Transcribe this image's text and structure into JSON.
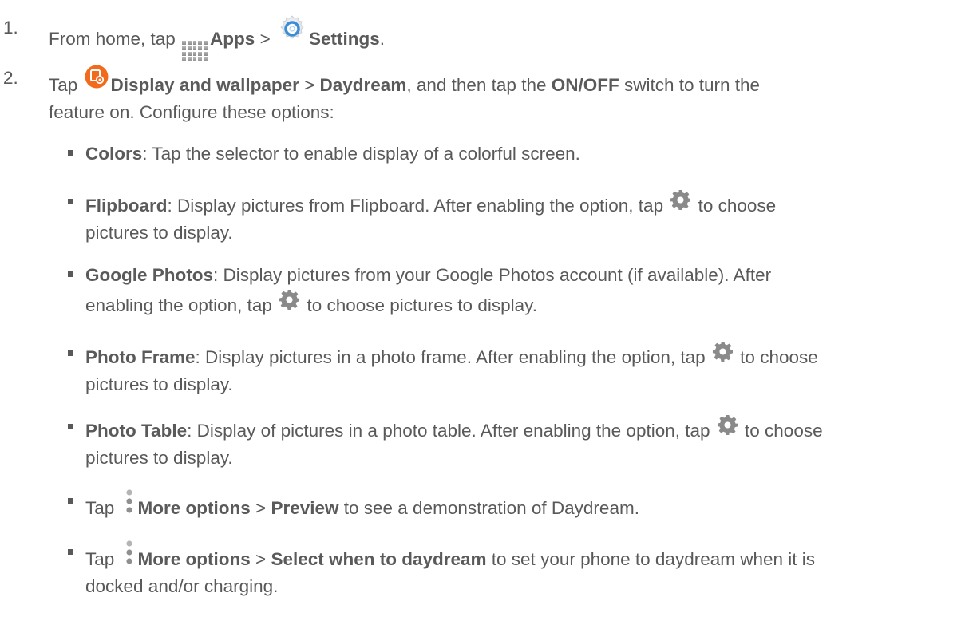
{
  "step1": {
    "number": "1.",
    "text_a": "From home, tap ",
    "apps_label": "Apps",
    "text_b": " > ",
    "settings_label": "Settings",
    "text_c": "."
  },
  "step2": {
    "number": "2.",
    "text_a": "Tap ",
    "display_label": "Display and wallpaper",
    "text_b": " > ",
    "daydream_label": "Daydream",
    "text_c": ", and then tap the ",
    "onoff_label": "ON/OFF",
    "text_d": " switch to turn the",
    "line2": "feature on. Configure these options:"
  },
  "options": [
    {
      "term": "Colors",
      "text": ": Tap the selector to enable display of a colorful screen."
    },
    {
      "term": "Flipboard",
      "text_a": ": Display pictures from Flipboard. After enabling the option, tap ",
      "text_b": " to choose",
      "line2": "pictures to display."
    },
    {
      "term": "Google Photos",
      "text_a": ": Display pictures from your Google Photos account (if available). After",
      "line2_a": "enabling the option, tap ",
      "line2_b": " to choose pictures to display."
    },
    {
      "term": "Photo Frame",
      "text_a": ": Display pictures in a photo frame. After enabling the option, tap ",
      "text_b": " to choose",
      "line2": "pictures to display."
    },
    {
      "term": "Photo Table",
      "text_a": ": Display of pictures in a photo table. After enabling the option, tap ",
      "text_b": " to choose",
      "line2": "pictures to display."
    },
    {
      "text_a": "Tap ",
      "more_label": "More options",
      "text_b": " > ",
      "preview_label": "Preview",
      "text_c": " to see a demonstration of Daydream."
    },
    {
      "text_a": "Tap ",
      "more_label": "More options",
      "text_b": " > ",
      "select_label": "Select when to daydream",
      "text_c": " to set your phone to daydream when it is",
      "line2": "docked and/or charging."
    }
  ],
  "icons": {
    "apps": "apps-grid-icon",
    "settings": "settings-icon",
    "display": "display-wallpaper-icon",
    "gear": "gear-icon",
    "more": "more-options-icon"
  },
  "colors": {
    "text": "#595959",
    "display_icon": "#f26b1d",
    "settings_ring": "#3b8ed6",
    "gear": "#8a8a8a"
  }
}
